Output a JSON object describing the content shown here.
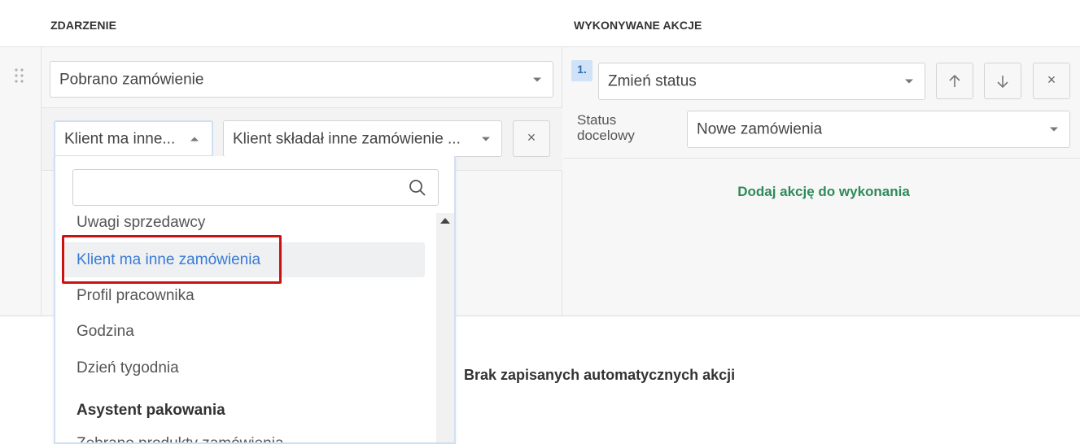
{
  "headers": {
    "event": "ZDARZENIE",
    "actions": "WYKONYWANE AKCJE"
  },
  "icons": {
    "drag": "drag-handle-icon",
    "search": "search-icon",
    "up": "arrow-up-icon",
    "down": "arrow-down-icon",
    "close": "close-icon"
  },
  "event_select": {
    "value": "Pobrano zamówienie"
  },
  "condition": {
    "type_value": "Klient ma inne...",
    "value_value": "Klient składał inne zamówienie ...",
    "remove_label": "×"
  },
  "dropdown": {
    "search_placeholder": "",
    "items": [
      "Uwagi sprzedawcy",
      "Klient ma inne zamówienia",
      "Profil pracownika",
      "Godzina",
      "Dzień tygodnia"
    ],
    "selected": "Klient ma inne zamówienia",
    "group_label": "Asystent pakowania",
    "cut_item": "Zebrano produkty zamówienia"
  },
  "action": {
    "number": "1.",
    "type_value": "Zmień status",
    "move_up": "↑",
    "move_down": "↓",
    "remove": "×",
    "status_label_line1": "Status",
    "status_label_line2": "docelowy",
    "status_value": "Nowe zamówienia",
    "add_action_link": "Dodaj akcję do wykonania"
  },
  "empty_message": "Brak zapisanych automatycznych akcji",
  "colors": {
    "link_green": "#2e8b57",
    "highlight_red": "#cc1111",
    "selected_blue": "#3a7bd5",
    "badge_bg": "#cfe2f7"
  }
}
